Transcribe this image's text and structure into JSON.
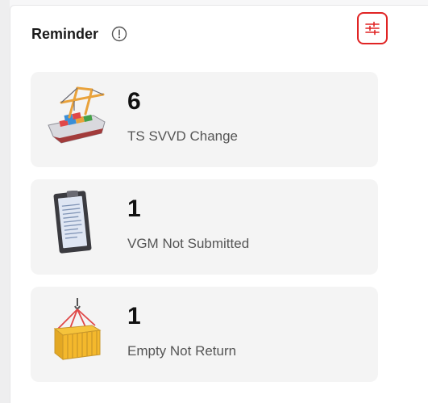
{
  "panel": {
    "title": "Reminder",
    "info_icon": "info-circle-icon",
    "filter_icon": "sliders-icon",
    "accent_color": "#e02424"
  },
  "reminders": [
    {
      "count": "6",
      "label": "TS SVVD Change",
      "icon": "container-ship-crane-icon"
    },
    {
      "count": "1",
      "label": "VGM Not Submitted",
      "icon": "clipboard-document-icon"
    },
    {
      "count": "1",
      "label": "Empty Not Return",
      "icon": "hoisted-container-icon"
    }
  ]
}
